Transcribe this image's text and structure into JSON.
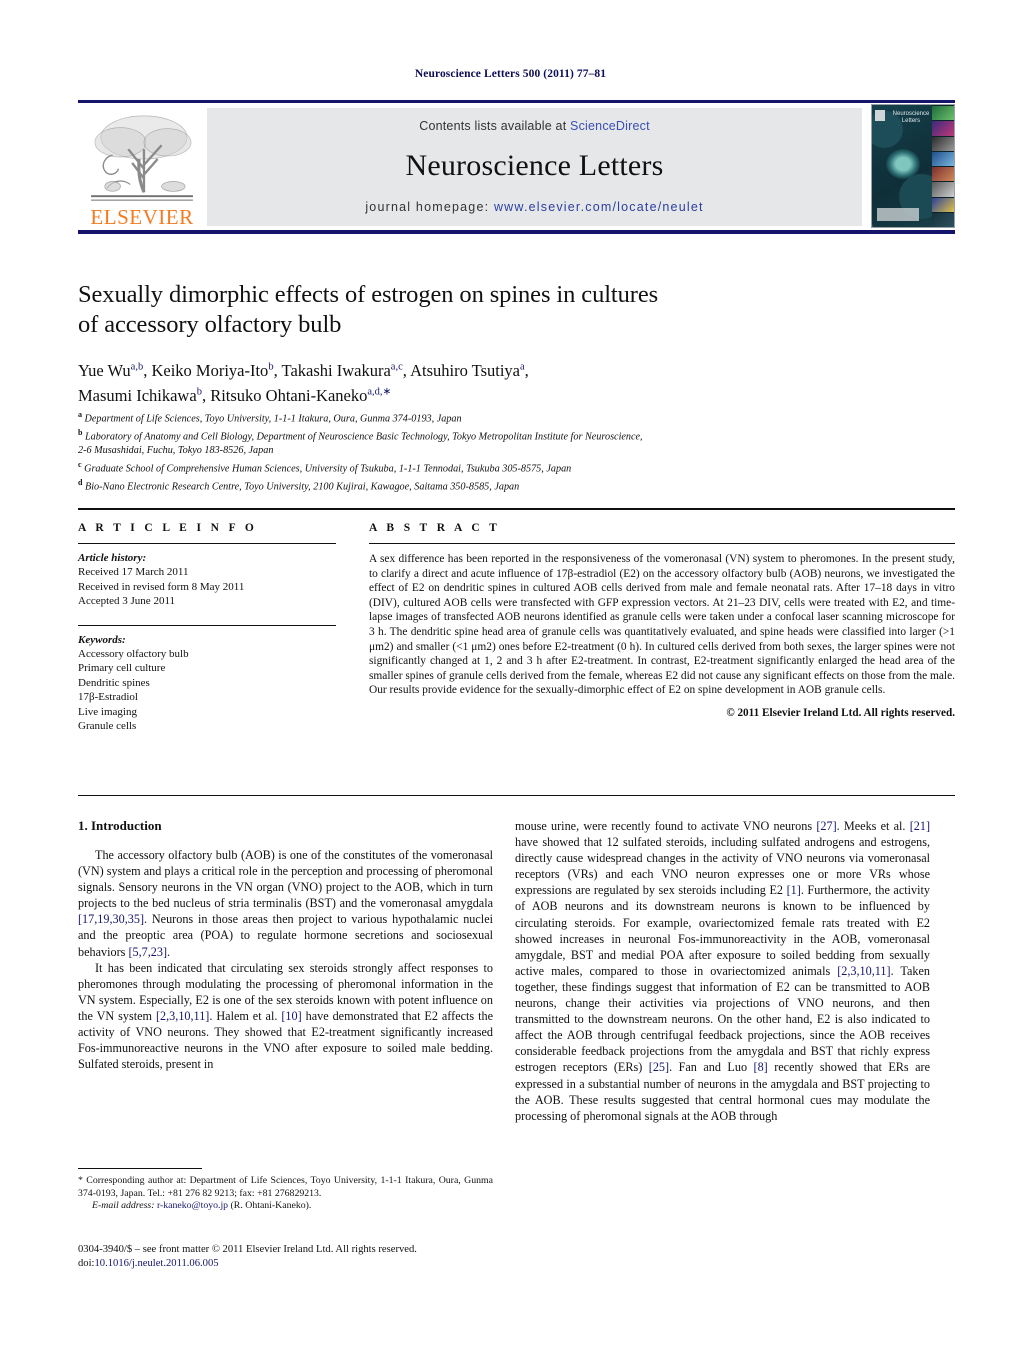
{
  "running_head": "Neuroscience Letters 500 (2011) 77–81",
  "masthead": {
    "contents_prefix": "Contents lists available at ",
    "contents_link": "ScienceDirect",
    "journal_name": "Neuroscience Letters",
    "homepage_prefix": "journal homepage: ",
    "homepage_url": "www.elsevier.com/locate/neulet",
    "publisher": "ELSEVIER",
    "publisher_color": "#F47B20",
    "link_color": "#2b3fa0",
    "rule_color": "#15166b",
    "band_color": "#e6e7e8",
    "cover_title": "Neuroscience Letters"
  },
  "article": {
    "title_line1": "Sexually dimorphic effects of estrogen on spines in cultures",
    "title_line2": "of accessory olfactory bulb",
    "authors_line1": "Yue Wu a,b, Keiko Moriya-Ito b, Takashi Iwakura a,c, Atsuhiro Tsutiya a,",
    "authors_line2": "Masumi Ichikawa b, Ritsuko Ohtani-Kaneko a,d,*",
    "affiliations": [
      {
        "marker": "a",
        "text": "Department of Life Sciences, Toyo University, 1-1-1 Itakura, Oura, Gunma 374-0193, Japan"
      },
      {
        "marker": "b",
        "text": "Laboratory of Anatomy and Cell Biology, Department of Neuroscience Basic Technology, Tokyo Metropolitan Institute for Neuroscience,"
      },
      {
        "marker": "",
        "text": "2-6 Musashidai, Fuchu, Tokyo 183-8526, Japan"
      },
      {
        "marker": "c",
        "text": "Graduate School of Comprehensive Human Sciences, University of Tsukuba, 1-1-1 Tennodai, Tsukuba 305-8575, Japan"
      },
      {
        "marker": "d",
        "text": "Bio-Nano Electronic Research Centre, Toyo University, 2100 Kujirai, Kawagoe, Saitama 350-8585, Japan"
      }
    ]
  },
  "article_info": {
    "heading": "A R T I C L E   I N F O",
    "history_label": "Article history:",
    "history": [
      "Received 17 March 2011",
      "Received in revised form 8 May 2011",
      "Accepted 3 June 2011"
    ],
    "keywords_label": "Keywords:",
    "keywords": [
      "Accessory olfactory bulb",
      "Primary cell culture",
      "Dendritic spines",
      "17β-Estradiol",
      "Live imaging",
      "Granule cells"
    ]
  },
  "abstract": {
    "heading": "A B S T R A C T",
    "text": "A sex difference has been reported in the responsiveness of the vomeronasal (VN) system to pheromones. In the present study, to clarify a direct and acute influence of 17β-estradiol (E2) on the accessory olfactory bulb (AOB) neurons, we investigated the effect of E2 on dendritic spines in cultured AOB cells derived from male and female neonatal rats. After 17–18 days in vitro (DIV), cultured AOB cells were transfected with GFP expression vectors. At 21–23 DIV, cells were treated with E2, and time-lapse images of transfected AOB neurons identified as granule cells were taken under a confocal laser scanning microscope for 3 h. The dendritic spine head area of granule cells was quantitatively evaluated, and spine heads were classified into larger (>1 μm2) and smaller (<1 μm2) ones before E2-treatment (0 h). In cultured cells derived from both sexes, the larger spines were not significantly changed at 1, 2 and 3 h after E2-treatment. In contrast, E2-treatment significantly enlarged the head area of the smaller spines of granule cells derived from the female, whereas E2 did not cause any significant effects on those from the male. Our results provide evidence for the sexually-dimorphic effect of E2 on spine development in AOB granule cells.",
    "copyright": "© 2011 Elsevier Ireland Ltd. All rights reserved."
  },
  "body": {
    "section_number": "1.",
    "section_title": "Introduction",
    "left_paragraphs": [
      "The accessory olfactory bulb (AOB) is one of the constitutes of the vomeronasal (VN) system and plays a critical role in the perception and processing of pheromonal signals. Sensory neurons in the VN organ (VNO) project to the AOB, which in turn projects to the bed nucleus of stria terminalis (BST) and the vomeronasal amygdala [17,19,30,35]. Neurons in those areas then project to various hypothalamic nuclei and the preoptic area (POA) to regulate hormone secretions and sociosexual behaviors [5,7,23].",
      "It has been indicated that circulating sex steroids strongly affect responses to pheromones through modulating the processing of pheromonal information in the VN system. Especially, E2 is one of the sex steroids known with potent influence on the VN system [2,3,10,11]. Halem et al. [10] have demonstrated that E2 affects the activity of VNO neurons. They showed that E2-treatment significantly increased Fos-immunoreactive neurons in the VNO after exposure to soiled male bedding. Sulfated steroids, present in"
    ],
    "right_paragraphs": [
      "mouse urine, were recently found to activate VNO neurons [27]. Meeks et al. [21] have showed that 12 sulfated steroids, including sulfated androgens and estrogens, directly cause widespread changes in the activity of VNO neurons via vomeronasal receptors (VRs) and each VNO neuron expresses one or more VRs whose expressions are regulated by sex steroids including E2 [1]. Furthermore, the activity of AOB neurons and its downstream neurons is known to be influenced by circulating steroids. For example, ovariectomized female rats treated with E2 showed increases in neuronal Fos-immunoreactivity in the AOB, vomeronasal amygdale, BST and medial POA after exposure to soiled bedding from sexually active males, compared to those in ovariectomized animals [2,3,10,11]. Taken together, these findings suggest that information of E2 can be transmitted to AOB neurons, change their activities via projections of VNO neurons, and then transmitted to the downstream neurons. On the other hand, E2 is also indicated to affect the AOB through centrifugal feedback projections, since the AOB receives considerable feedback projections from the amygdala and BST that richly express estrogen receptors (ERs) [25]. Fan and Luo [8] recently showed that ERs are expressed in a substantial number of neurons in the amygdala and BST projecting to the AOB. These results suggested that central hormonal cues may modulate the processing of pheromonal signals at the AOB through"
    ]
  },
  "footnotes": {
    "corresponding": "* Corresponding author at: Department of Life Sciences, Toyo University, 1-1-1 Itakura, Oura, Gunma 374-0193, Japan. Tel.: +81 276 82 9213; fax: +81 276829213.",
    "email_label": "E-mail address:",
    "email": "r-kaneko@toyo.jp",
    "email_owner": "(R. Ohtani-Kaneko).",
    "issn_line": "0304-3940/$ – see front matter © 2011 Elsevier Ireland Ltd. All rights reserved.",
    "doi_label": "doi:",
    "doi": "10.1016/j.neulet.2011.06.005"
  }
}
